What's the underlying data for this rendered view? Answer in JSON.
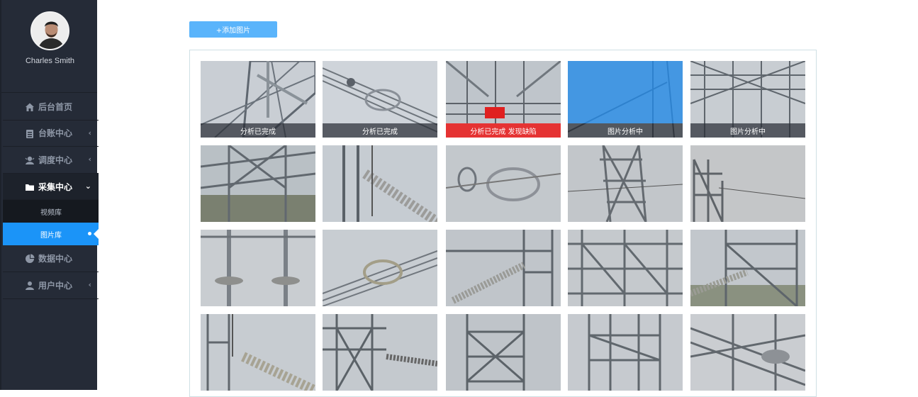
{
  "user": {
    "name": "Charles Smith"
  },
  "menu": {
    "items": [
      {
        "label": "后台首页",
        "icon": "home-icon",
        "chevron": ""
      },
      {
        "label": "台账中心",
        "icon": "ledger-icon",
        "chevron": "‹"
      },
      {
        "label": "调度中心",
        "icon": "dispatch-icon",
        "chevron": "‹"
      },
      {
        "label": "采集中心",
        "icon": "folder-icon",
        "chevron": "⌄"
      },
      {
        "label": "数据中心",
        "icon": "pie-chart-icon",
        "chevron": ""
      },
      {
        "label": "用户中心",
        "icon": "user-icon",
        "chevron": "‹"
      }
    ],
    "sub_items": [
      {
        "label": "视频库"
      },
      {
        "label": "图片库"
      }
    ]
  },
  "toolbar": {
    "add_label": "+添加图片"
  },
  "gallery": {
    "captions": [
      "分析已完成",
      "分析已完成",
      "分析已完成 发现缺陷",
      "图片分析中",
      "图片分析中"
    ]
  },
  "colors": {
    "accent": "#1b94f8",
    "button": "#5ab4fb",
    "sidebar": "#252b37",
    "defect": "#e53333"
  }
}
